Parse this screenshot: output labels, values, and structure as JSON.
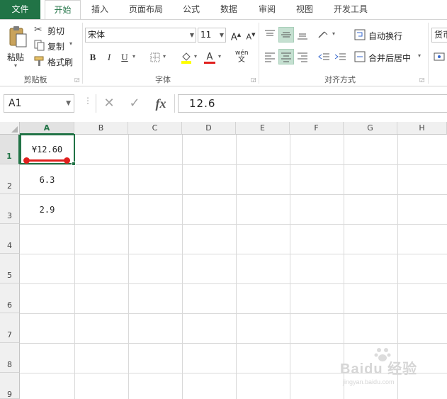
{
  "tabs": [
    "文件",
    "开始",
    "插入",
    "页面布局",
    "公式",
    "数据",
    "审阅",
    "视图",
    "开发工具"
  ],
  "active_tab": "开始",
  "clipboard": {
    "paste_label": "粘贴",
    "cut_label": "剪切",
    "copy_label": "复制",
    "format_painter_label": "格式刷",
    "group_label": "剪贴板"
  },
  "font": {
    "font_name": "宋体",
    "font_size": "11",
    "bold": "B",
    "italic": "I",
    "underline": "U",
    "phonetic": "wén",
    "phonetic_sub": "文",
    "grow_font": "A",
    "shrink_font": "A",
    "font_color_letter": "A",
    "group_label": "字体"
  },
  "alignment": {
    "wrap_text_label": "自动换行",
    "merge_center_label": "合并后居中",
    "group_label": "对齐方式"
  },
  "number": {
    "format_label": "货币"
  },
  "formula_bar": {
    "name_box": "A1",
    "cancel_icon": "✕",
    "enter_icon": "✓",
    "fx_label": "fx",
    "formula_value": "12.6"
  },
  "columns": [
    "A",
    "B",
    "C",
    "D",
    "E",
    "F",
    "G",
    "H"
  ],
  "rows": [
    "1",
    "2",
    "3",
    "4",
    "5",
    "6",
    "7",
    "8",
    "9"
  ],
  "cells": {
    "A1": "¥12.60",
    "A2": "6.3",
    "A3": "2.9"
  },
  "watermark": {
    "main": "Baidu 经验",
    "sub": "jingyan.baidu.com"
  },
  "colors": {
    "accent": "#217346",
    "annotation": "#e0201e"
  }
}
